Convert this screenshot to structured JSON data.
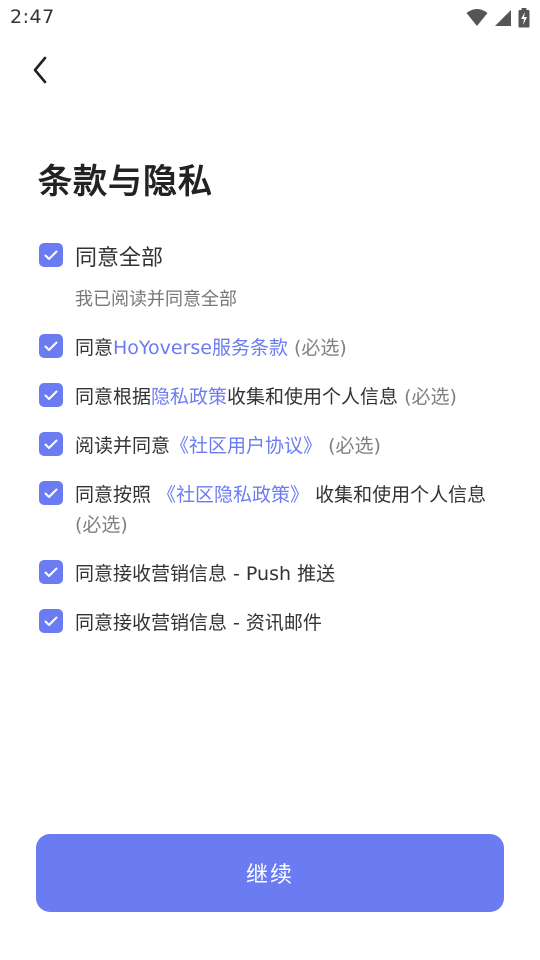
{
  "status_bar": {
    "time": "2:47"
  },
  "title": "条款与隐私",
  "select_all": {
    "label": "同意全部",
    "subtext": "我已阅读并同意全部",
    "checked": true
  },
  "items": [
    {
      "prefix": "同意",
      "link": "HoYoverse服务条款",
      "suffix": "",
      "required": " (必选)",
      "checked": true
    },
    {
      "prefix": "同意根据",
      "link": "隐私政策",
      "suffix": "收集和使用个人信息",
      "required": " (必选)",
      "checked": true
    },
    {
      "prefix": "阅读并同意",
      "link": "《社区用户协议》",
      "suffix": "",
      "required": " (必选)",
      "checked": true
    },
    {
      "prefix": "同意按照",
      "link": " 《社区隐私政策》 ",
      "suffix": "收集和使用个人信息",
      "required": " (必选)",
      "checked": true
    },
    {
      "prefix": "同意接收营销信息 - Push 推送",
      "checked": true
    },
    {
      "prefix": "同意接收营销信息 - 资讯邮件",
      "checked": true
    }
  ],
  "continue_button": {
    "label": "继续"
  },
  "colors": {
    "accent": "#6b7cf2",
    "text": "#333333",
    "muted": "#808080"
  }
}
